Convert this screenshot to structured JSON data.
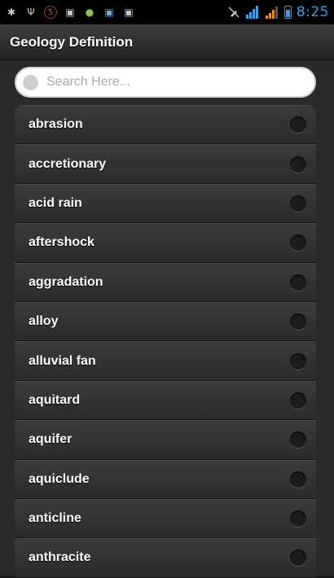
{
  "status_bar": {
    "time": "8:25",
    "notification_icons": [
      {
        "icon": "usb-debug-icon",
        "glyph": "✱"
      },
      {
        "icon": "usb-icon",
        "glyph": "Ψ"
      },
      {
        "icon": "badge-icon",
        "glyph": "5"
      },
      {
        "icon": "chat-icon",
        "glyph": "▣"
      },
      {
        "icon": "android-icon",
        "glyph": "●"
      },
      {
        "icon": "image-icon",
        "glyph": "▣"
      },
      {
        "icon": "message-icon",
        "glyph": "▣"
      }
    ],
    "accent_color": "#39a0e8"
  },
  "app": {
    "title": "Geology Definition"
  },
  "search": {
    "placeholder": "Search Here..."
  },
  "list": {
    "items": [
      {
        "label": "abrasion"
      },
      {
        "label": "accretionary"
      },
      {
        "label": "acid rain"
      },
      {
        "label": "aftershock"
      },
      {
        "label": "aggradation"
      },
      {
        "label": "alloy"
      },
      {
        "label": "alluvial fan"
      },
      {
        "label": "aquitard"
      },
      {
        "label": "aquifer"
      },
      {
        "label": "aquiclude"
      },
      {
        "label": "anticline"
      },
      {
        "label": "anthracite"
      }
    ]
  }
}
